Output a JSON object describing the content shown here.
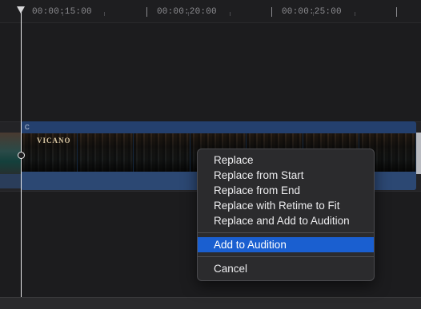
{
  "ruler": {
    "timecodes": [
      "00:00:15:00",
      "00:00:20:00",
      "00:00:25:00"
    ]
  },
  "timeline": {
    "clip_name": "C",
    "frame_sign_text": "VICANO"
  },
  "context_menu": {
    "items": [
      "Replace",
      "Replace from Start",
      "Replace from End",
      "Replace with Retime to Fit",
      "Replace and Add to Audition",
      "Add to Audition",
      "Cancel"
    ],
    "highlighted": "Add to Audition"
  },
  "colors": {
    "accent": "#1a5fd0",
    "clip": "#24406e",
    "background": "#1b1b1d"
  }
}
